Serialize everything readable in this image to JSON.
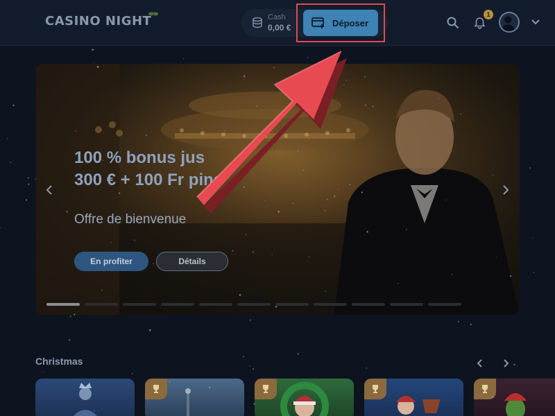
{
  "header": {
    "logo_text": "CASINO NIGHT",
    "wallet": {
      "label": "Cash",
      "amount": "0,00 €"
    },
    "deposit_label": "Déposer",
    "notification_count": "1",
    "icons": [
      "search-icon",
      "bell-icon",
      "avatar",
      "chevron-down-icon"
    ]
  },
  "hero": {
    "title": "100 % bonus jus\n300 € + 100 Fr      pins",
    "subtitle": "Offre de bienvenue",
    "primary_button": "En profiter",
    "secondary_button": "Détails",
    "slide_count": 11,
    "active_slide": 0
  },
  "section": {
    "title": "Christmas",
    "cards": [
      {
        "name": "ice-queen-game",
        "trophy": false
      },
      {
        "name": "christmas-tree-game",
        "trophy": true
      },
      {
        "name": "santa-wreath-game",
        "trophy": true
      },
      {
        "name": "santa-sleigh-game",
        "trophy": true
      },
      {
        "name": "grinch-game",
        "trophy": true
      }
    ]
  },
  "colors": {
    "background": "#0d1420",
    "header": "#121c2c",
    "deposit_button": "#3f82b4",
    "highlight": "#e34a52",
    "badge": "#b8923b"
  }
}
